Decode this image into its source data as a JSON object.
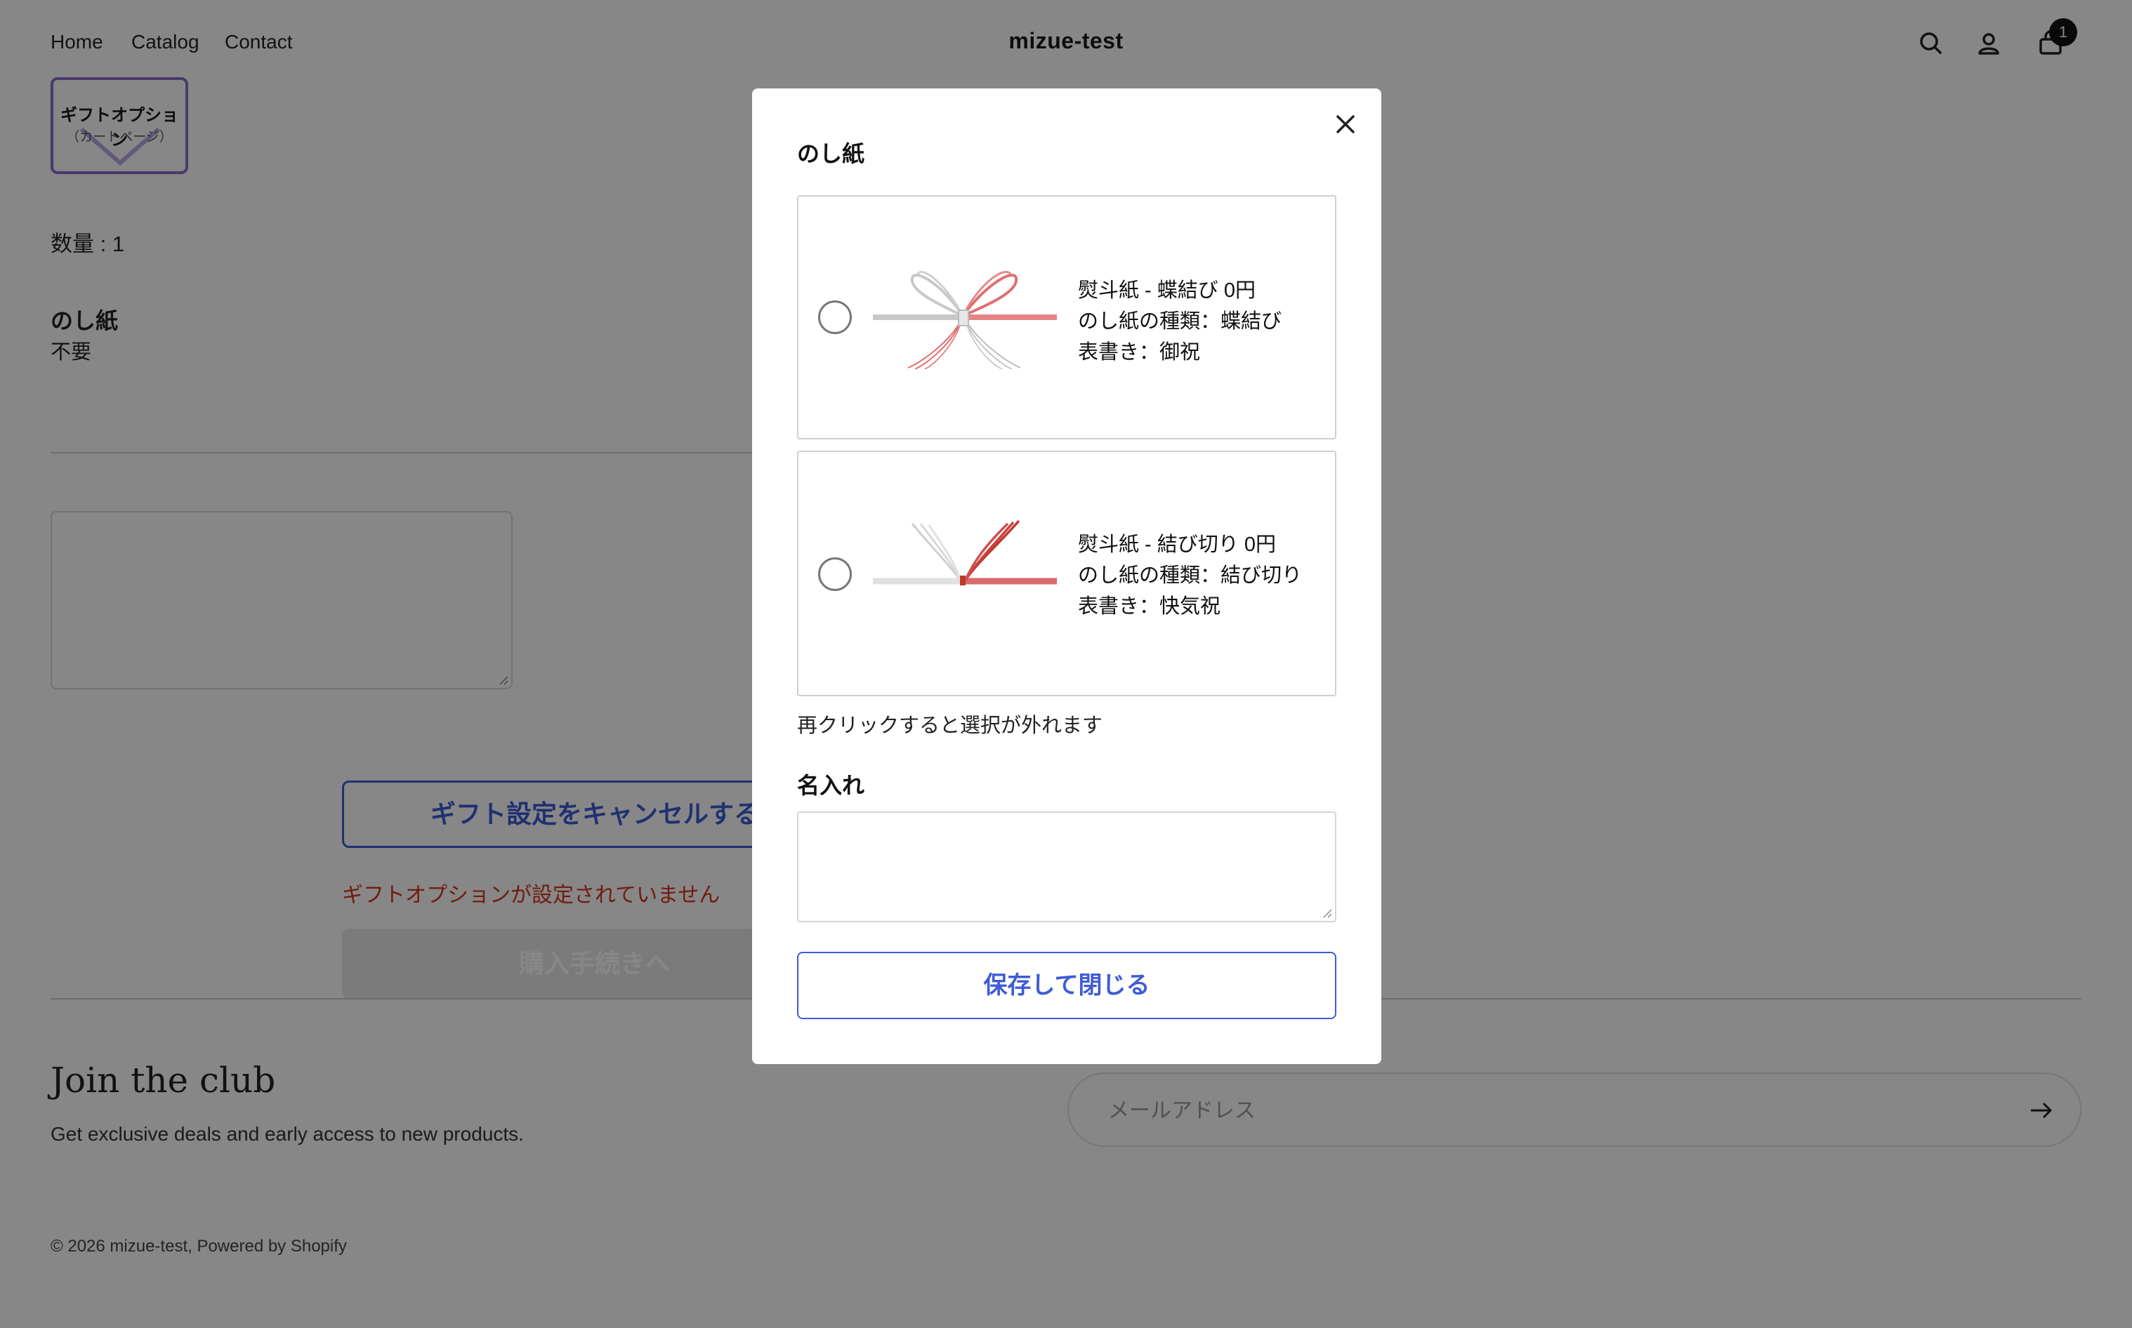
{
  "header": {
    "nav": [
      "Home",
      "Catalog",
      "Contact"
    ],
    "store_name": "mizue-test",
    "icons": [
      "search-icon",
      "account-icon",
      "cart-icon"
    ],
    "cart_count": "1"
  },
  "cart_item": {
    "thumb_title": "ギフトオプション",
    "thumb_subtitle": "（カートページ）",
    "quantity": "数量 : 1",
    "noshi_label": "のし紙",
    "noshi_value": "不要"
  },
  "actions": {
    "cancel_gift": "ギフト設定をキャンセルする",
    "error": "ギフトオプションが設定されていません",
    "checkout": "購入手続きへ"
  },
  "footer": {
    "title": "Join the club",
    "subtitle": "Get exclusive deals and early access to new products.",
    "email_placeholder": "メールアドレス",
    "copyright": "© 2026 mizue-test, Powered by Shopify"
  },
  "modal": {
    "heading": "のし紙",
    "options": [
      {
        "line1": "熨斗紙 - 蝶結び 0円",
        "line2": "のし紙の種類：蝶結び",
        "line3": "表書き：御祝",
        "selected": false
      },
      {
        "line1": "熨斗紙 - 結び切り 0円",
        "line2": "のし紙の種類：結び切り",
        "line3": "表書き：快気祝",
        "selected": false
      }
    ],
    "hint": "再クリックすると選択が外れます",
    "name_heading": "名入れ",
    "name_value": "",
    "save_label": "保存して閉じる"
  },
  "colors": {
    "accent": "#3e5bd6",
    "error": "#d6331f",
    "overlay": "rgba(0,0,0,0.47)"
  }
}
